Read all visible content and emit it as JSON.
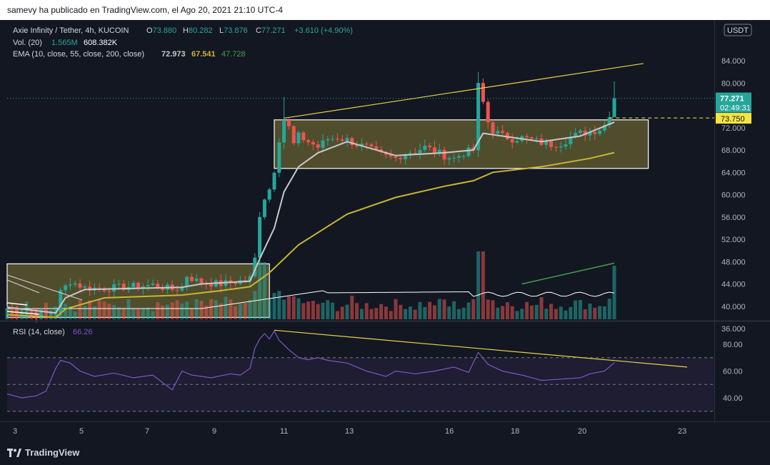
{
  "header": {
    "author_line": "samevy ha publicado en TradingView.com, el Ago 20, 2021 21:10 UTC-4"
  },
  "legend": {
    "symbol": "Axie Infinity / Tether, 4h, KUCOIN",
    "ohlc": [
      {
        "k": "O",
        "v": "73.880"
      },
      {
        "k": "H",
        "v": "80.282"
      },
      {
        "k": "L",
        "v": "73.876"
      },
      {
        "k": "C",
        "v": "77.271"
      }
    ],
    "change": "+3.610 (+4.90%)",
    "vol_label": "Vol. (20)",
    "vol_values": [
      "1.565M",
      "608.382K"
    ],
    "ema_label": "EMA (10, close, 55, close, 200, close)",
    "ema_values": [
      "72.973",
      "67.541",
      "47.728"
    ]
  },
  "rsi_legend": {
    "label": "RSI (14, close)",
    "value": "66.26"
  },
  "price_scale": {
    "currency": "USDT",
    "ticks": [
      "84.000",
      "80.000",
      "76.000",
      "72.000",
      "68.000",
      "64.000",
      "60.000",
      "56.000",
      "52.000",
      "48.000",
      "44.000",
      "40.000",
      "36.000"
    ],
    "last_price": "77.271",
    "countdown": "02:49:31",
    "level_label": "73.750"
  },
  "rsi_scale": {
    "ticks": [
      "80.00",
      "60.00",
      "40.00"
    ]
  },
  "time_axis": {
    "labels": [
      "3",
      "5",
      "7",
      "9",
      "11",
      "13",
      "16",
      "18",
      "20",
      "23"
    ]
  },
  "colors": {
    "up": "#26a69a",
    "down": "#ef5350",
    "ema10": "#c9c9c9",
    "ema55": "#c9b534",
    "ema200": "#43a047",
    "rsi": "#7e57c2",
    "box_fill": "#827a35",
    "trend": "#e8d44a",
    "last_price": "#26a69a",
    "level": "#f4e542"
  },
  "chart_data": {
    "type": "candlestick",
    "title": "Axie Infinity / Tether, 4h, KUCOIN",
    "timeframe": "4h",
    "x_labels": [
      "3",
      "5",
      "7",
      "9",
      "11",
      "13",
      "16",
      "18",
      "20",
      "23"
    ],
    "ylim": [
      34,
      86
    ],
    "y_scale": "linear",
    "grid": false,
    "last": {
      "open": 73.88,
      "high": 80.282,
      "low": 73.876,
      "close": 77.271,
      "change": 3.61,
      "change_pct": 4.9
    },
    "close_path": [
      [
        0,
        39.6
      ],
      [
        4,
        39.0
      ],
      [
        8,
        38.6
      ],
      [
        10,
        39.2
      ],
      [
        11,
        42.5
      ],
      [
        13,
        44.5
      ],
      [
        16,
        43.3
      ],
      [
        20,
        43.2
      ],
      [
        25,
        43.5
      ],
      [
        30,
        43.8
      ],
      [
        34,
        43.0
      ],
      [
        36,
        43.4
      ],
      [
        37,
        45.5
      ],
      [
        38,
        45.0
      ],
      [
        40,
        44.2
      ],
      [
        44,
        44.0
      ],
      [
        48,
        44.5
      ],
      [
        50,
        45.0
      ],
      [
        51,
        48.5
      ],
      [
        52,
        56.5
      ],
      [
        53,
        59.5
      ],
      [
        54,
        61.0
      ],
      [
        55,
        64.5
      ],
      [
        56,
        70.0
      ],
      [
        57,
        73.5
      ],
      [
        58,
        72.0
      ],
      [
        59,
        69.0
      ],
      [
        60,
        70.5
      ],
      [
        62,
        69.5
      ],
      [
        64,
        68.5
      ],
      [
        66,
        70.0
      ],
      [
        68,
        70.2
      ],
      [
        70,
        69.8
      ],
      [
        72,
        69.0
      ],
      [
        74,
        68.5
      ],
      [
        76,
        67.5
      ],
      [
        78,
        66.8
      ],
      [
        80,
        66.5
      ],
      [
        82,
        67.5
      ],
      [
        84,
        67.8
      ],
      [
        86,
        68.5
      ],
      [
        88,
        67.8
      ],
      [
        90,
        67.0
      ],
      [
        92,
        66.5
      ],
      [
        94,
        67.5
      ],
      [
        96,
        68.0
      ],
      [
        97,
        79.5
      ],
      [
        98,
        76.5
      ],
      [
        99,
        73.0
      ],
      [
        100,
        71.5
      ],
      [
        102,
        70.5
      ],
      [
        104,
        70.0
      ],
      [
        106,
        70.2
      ],
      [
        108,
        69.8
      ],
      [
        110,
        69.3
      ],
      [
        112,
        69.0
      ],
      [
        114,
        69.2
      ],
      [
        116,
        70.2
      ],
      [
        118,
        71.0
      ],
      [
        120,
        71.2
      ],
      [
        122,
        71.8
      ],
      [
        123,
        72.5
      ],
      [
        124,
        73.88
      ],
      [
        125,
        77.271
      ]
    ],
    "ema_series": [
      {
        "name": "EMA 10",
        "last": 72.973,
        "values": [
          [
            0,
            39.8
          ],
          [
            10,
            38.8
          ],
          [
            12,
            41.5
          ],
          [
            16,
            43.0
          ],
          [
            36,
            43.4
          ],
          [
            40,
            44.0
          ],
          [
            50,
            44.5
          ],
          [
            52,
            48.5
          ],
          [
            55,
            54.0
          ],
          [
            57,
            60.5
          ],
          [
            60,
            65.0
          ],
          [
            64,
            67.5
          ],
          [
            70,
            69.5
          ],
          [
            80,
            67.0
          ],
          [
            90,
            67.5
          ],
          [
            96,
            68.0
          ],
          [
            98,
            71.0
          ],
          [
            102,
            70.5
          ],
          [
            110,
            69.5
          ],
          [
            118,
            70.5
          ],
          [
            125,
            72.973
          ]
        ]
      },
      {
        "name": "EMA 55",
        "last": 67.541,
        "values": [
          [
            0,
            38.5
          ],
          [
            10,
            38.0
          ],
          [
            12,
            39.5
          ],
          [
            20,
            41.5
          ],
          [
            36,
            42.0
          ],
          [
            44,
            42.8
          ],
          [
            50,
            43.5
          ],
          [
            54,
            46.0
          ],
          [
            60,
            51.0
          ],
          [
            70,
            56.5
          ],
          [
            80,
            59.5
          ],
          [
            90,
            61.5
          ],
          [
            96,
            62.5
          ],
          [
            100,
            64.0
          ],
          [
            110,
            65.0
          ],
          [
            120,
            66.5
          ],
          [
            125,
            67.541
          ]
        ]
      },
      {
        "name": "EMA 200",
        "last": 47.728,
        "values": [
          [
            106,
            44.0
          ],
          [
            125,
            47.728
          ]
        ]
      }
    ],
    "volume": {
      "last": "1.565M",
      "ma20": "608.382K"
    },
    "rsi": {
      "length": 14,
      "last": 66.26,
      "bands": [
        70,
        50,
        30
      ],
      "values": [
        [
          0,
          43.0
        ],
        [
          3,
          40.0
        ],
        [
          6,
          41.5
        ],
        [
          8,
          45.0
        ],
        [
          10,
          62.0
        ],
        [
          11,
          68.0
        ],
        [
          13,
          66.0
        ],
        [
          15,
          60.0
        ],
        [
          18,
          56.0
        ],
        [
          22,
          58.5
        ],
        [
          26,
          55.0
        ],
        [
          30,
          57.0
        ],
        [
          34,
          46.0
        ],
        [
          36,
          60.0
        ],
        [
          38,
          57.0
        ],
        [
          42,
          55.0
        ],
        [
          46,
          58.0
        ],
        [
          48,
          57.0
        ],
        [
          50,
          62.0
        ],
        [
          51,
          77.0
        ],
        [
          52,
          84.0
        ],
        [
          53,
          88.0
        ],
        [
          54,
          84.0
        ],
        [
          55,
          90.0
        ],
        [
          56,
          83.0
        ],
        [
          58,
          76.0
        ],
        [
          60,
          70.0
        ],
        [
          62,
          68.5
        ],
        [
          64,
          70.0
        ],
        [
          66,
          68.0
        ],
        [
          70,
          66.0
        ],
        [
          74,
          60.0
        ],
        [
          78,
          56.0
        ],
        [
          80,
          60.0
        ],
        [
          84,
          58.0
        ],
        [
          88,
          60.0
        ],
        [
          92,
          63.0
        ],
        [
          95,
          59.0
        ],
        [
          97,
          74.0
        ],
        [
          99,
          65.0
        ],
        [
          102,
          60.0
        ],
        [
          106,
          57.0
        ],
        [
          110,
          53.0
        ],
        [
          114,
          54.0
        ],
        [
          118,
          55.0
        ],
        [
          120,
          58.0
        ],
        [
          123,
          60.0
        ],
        [
          125,
          66.26
        ]
      ]
    },
    "trendlines": [
      {
        "name": "resistance",
        "from": [
          57,
          73.7
        ],
        "to": [
          131,
          83.5
        ]
      },
      {
        "name": "rsi-resistance",
        "from": [
          55,
          90.5
        ],
        "to": [
          140,
          63.0
        ]
      }
    ],
    "ranges": [
      {
        "name": "first-consolidation",
        "y": [
          38.0,
          47.6
        ],
        "x": [
          0,
          54
        ]
      },
      {
        "name": "second-consolidation",
        "y": [
          64.7,
          73.4
        ],
        "x": [
          55,
          132
        ]
      }
    ]
  }
}
